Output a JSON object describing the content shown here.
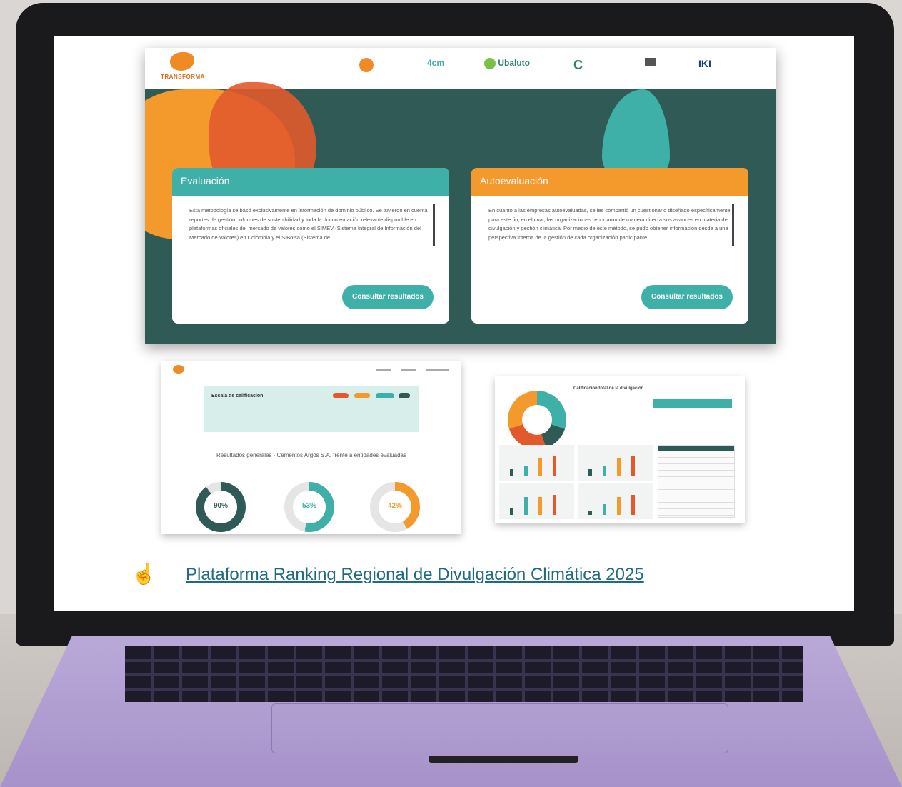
{
  "header": {
    "brand": "TRANSFORMA",
    "partners": [
      "",
      "",
      "Ubaluto",
      "",
      "",
      "IKI"
    ]
  },
  "cards": {
    "evaluacion": {
      "title": "Evaluación",
      "text": "Esta metodología se basó exclusivamente en información de dominio público. Se tuvieron en cuenta reportes de gestión, informes de sostenibilidad y toda la documentación relevante disponible en plataformas oficiales del mercado de valores como el SIMEV (Sistema Integral de Información del Mercado de Valores) en Colombia y el SIBolsa (Sistema de",
      "button": "Consultar resultados"
    },
    "autoevaluacion": {
      "title": "Autoevaluación",
      "text": "En cuanto a las empresas autoevaluadas, se les compartió un cuestionario diseñado específicamente para este fin, en el cual, las organizaciones reportaron de manera directa sus avances en materia de divulgación y gestión climática. Por medio de este método, se pudo obtener información desde a una perspectiva interna de la gestión de cada organización participante",
      "button": "Consultar resultados"
    }
  },
  "screenshot1": {
    "scale_title": "Escala de calificación",
    "results_title": "Resultados generales - Cementos Argos S.A. frente a entidades evaluadas",
    "donuts": [
      "90%",
      "53%",
      "42%"
    ]
  },
  "screenshot2": {
    "title": "Calificación total de la divulgación"
  },
  "link": {
    "text": "Plataforma Ranking Regional de Divulgación Climática 2025"
  },
  "colors": {
    "teal": "#3fb0a8",
    "dark_teal": "#2f5a55",
    "orange": "#f49a2c",
    "link": "#1e6b82"
  },
  "icons": {
    "pointer": "hand-pointer-icon"
  }
}
